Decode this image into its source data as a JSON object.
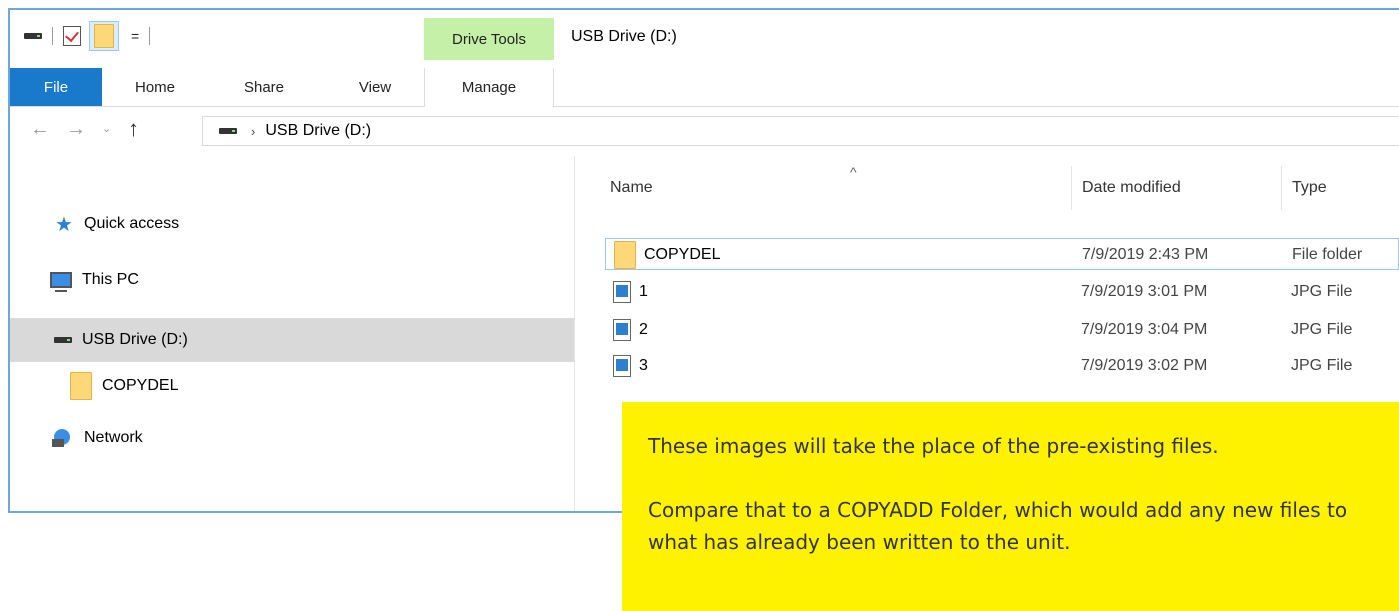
{
  "window": {
    "title": "USB Drive (D:)",
    "context_tab_group": "Drive Tools"
  },
  "quick_access_toolbar": {
    "icons": [
      "drive-icon",
      "properties-check-icon",
      "new-folder-icon",
      "customize-dropdown-icon"
    ],
    "dropdown_glyph": "="
  },
  "ribbon": {
    "tabs": [
      {
        "label": "File",
        "active": true
      },
      {
        "label": "Home"
      },
      {
        "label": "Share"
      },
      {
        "label": "View"
      },
      {
        "label": "Manage"
      }
    ],
    "file_tab_color": "#1979ca",
    "context_tab_color": "#c4f0a8"
  },
  "address_bar": {
    "back_glyph": "←",
    "forward_glyph": "→",
    "recent_glyph": "⌄",
    "up_glyph": "↑",
    "separator": "›",
    "path": "USB Drive (D:)"
  },
  "nav_pane": {
    "items": [
      {
        "label": "Quick access",
        "icon": "star-icon"
      },
      {
        "label": "This PC",
        "icon": "monitor-icon"
      },
      {
        "label": "USB Drive (D:)",
        "icon": "drive-icon",
        "selected": true
      },
      {
        "label": "COPYDEL",
        "icon": "folder-icon"
      },
      {
        "label": "Network",
        "icon": "network-icon"
      }
    ]
  },
  "file_list": {
    "columns": [
      "Name",
      "Date modified",
      "Type"
    ],
    "sort_glyph": "^",
    "rows": [
      {
        "name": "COPYDEL",
        "date": "7/9/2019 2:43 PM",
        "type": "File folder",
        "icon": "folder-icon"
      },
      {
        "name": "1",
        "date": "7/9/2019 3:01 PM",
        "type": "JPG File",
        "icon": "jpg-file-icon"
      },
      {
        "name": "2",
        "date": "7/9/2019 3:04 PM",
        "type": "JPG File",
        "icon": "jpg-file-icon"
      },
      {
        "name": "3",
        "date": "7/9/2019 3:02 PM",
        "type": "JPG File",
        "icon": "jpg-file-icon"
      }
    ]
  },
  "callout": {
    "line1": "These images will take the place of the pre-existing files.",
    "line2": "Compare that to a COPYADD Folder, which would add any new files to what has already been written to the unit.",
    "background": "#fff200"
  }
}
